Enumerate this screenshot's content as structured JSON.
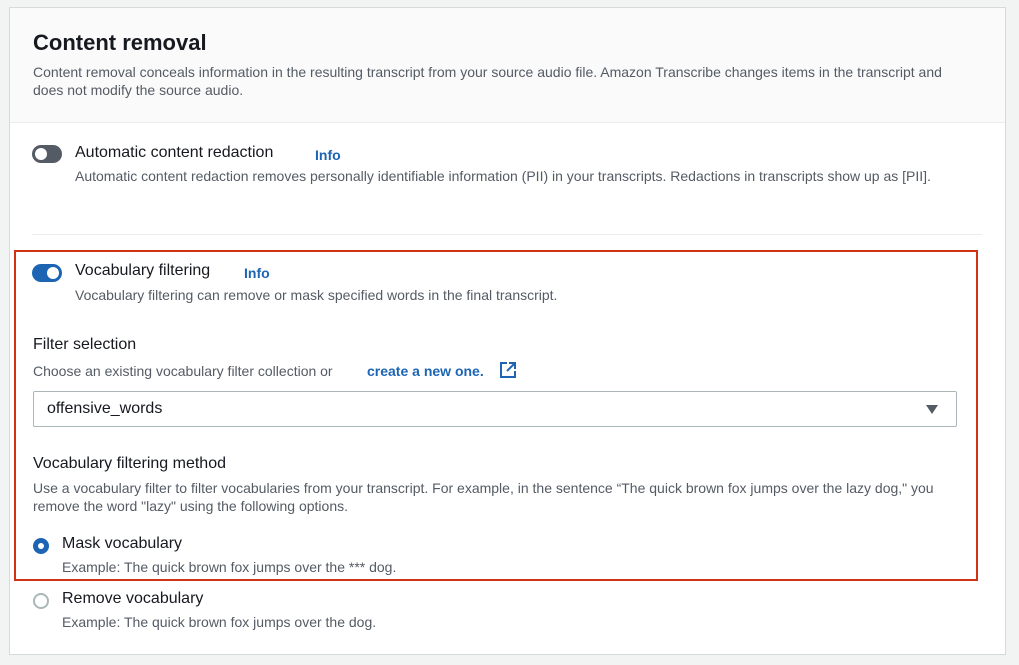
{
  "section": {
    "title": "Content removal",
    "description": "Content removal conceals information in the resulting transcript from your source audio file. Amazon Transcribe changes items in the transcript and does not modify the source audio."
  },
  "redaction": {
    "label": "Automatic content redaction",
    "info": "Info",
    "enabled": false,
    "description": "Automatic content redaction removes personally identifiable information (PII) in your transcripts. Redactions in transcripts show up as [PII]."
  },
  "vocab_filtering": {
    "label": "Vocabulary filtering",
    "info": "Info",
    "enabled": true,
    "description": "Vocabulary filtering can remove or mask specified words in the final transcript."
  },
  "filter_selection": {
    "label": "Filter selection",
    "hint": "Choose an existing vocabulary filter collection or",
    "link": "create a new one.",
    "selected": "offensive_words"
  },
  "method": {
    "label": "Vocabulary filtering method",
    "description": "Use a vocabulary filter to filter vocabularies from your transcript. For example, in the sentence “The quick brown fox jumps over the lazy dog,\" you remove the word \"lazy\" using the following options.",
    "options": [
      {
        "label": "Mask vocabulary",
        "example": "Example: The quick brown fox jumps over the *** dog.",
        "checked": true
      },
      {
        "label": "Remove vocabulary",
        "example": "Example: The quick brown fox jumps over the dog.",
        "checked": false
      }
    ]
  },
  "colors": {
    "accent": "#1d65b3",
    "highlight_border": "#d13212",
    "toggle_off": "#545b64"
  },
  "icons": [
    "external-link-icon",
    "caret-down-icon"
  ]
}
